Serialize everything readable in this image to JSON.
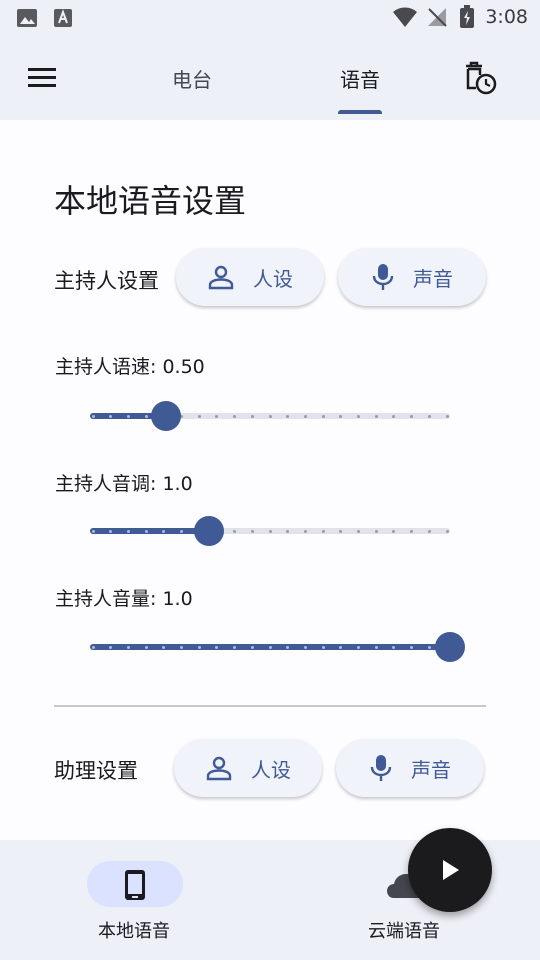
{
  "status_bar": {
    "time": "3:08"
  },
  "app_bar": {
    "tabs": [
      {
        "label": "电台",
        "selected": false
      },
      {
        "label": "语音",
        "selected": true
      }
    ]
  },
  "main": {
    "title": "本地语音设置",
    "host": {
      "label": "主持人设置",
      "persona_button": "人设",
      "voice_button": "声音"
    },
    "sliders": [
      {
        "label": "主持人语速: 0.50",
        "fraction": 0.21
      },
      {
        "label": "主持人音调: 1.0",
        "fraction": 0.33
      },
      {
        "label": "主持人音量: 1.0",
        "fraction": 1.0
      }
    ],
    "assistant": {
      "label": "助理设置",
      "persona_button": "人设",
      "voice_button": "声音"
    }
  },
  "bottom_nav": {
    "items": [
      {
        "label": "本地语音",
        "selected": true
      },
      {
        "label": "云端语音",
        "selected": false
      }
    ]
  },
  "colors": {
    "accent": "#405a96",
    "surface": "#eef0f7",
    "fab": "#1b1b1d"
  }
}
